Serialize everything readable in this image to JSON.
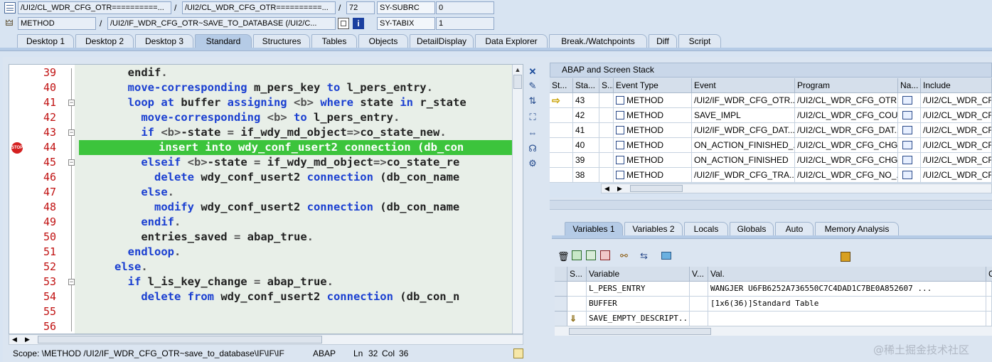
{
  "header": {
    "row1": {
      "class_field": "/UI2/CL_WDR_CFG_OTR==========...",
      "class_field2": "/UI2/CL_WDR_CFG_OTR==========...",
      "line_no": "72",
      "sysvar_name": "SY-SUBRC",
      "sysvar_value": "0",
      "separator": "/"
    },
    "row2": {
      "type": "METHOD",
      "method_path": "/UI2/IF_WDR_CFG_OTR~SAVE_TO_DATABASE (/UI2/C...",
      "sysvar_name": "SY-TABIX",
      "sysvar_value": "1",
      "separator": "/"
    }
  },
  "tabs": [
    "Desktop 1",
    "Desktop 2",
    "Desktop 3",
    "Standard",
    "Structures",
    "Tables",
    "Objects",
    "DetailDisplay",
    "Data Explorer",
    "Break./Watchpoints",
    "Diff",
    "Script"
  ],
  "active_tab": "Standard",
  "editor": {
    "lines": [
      {
        "n": "39",
        "parts": [
          [
            "",
            "        "
          ],
          [
            "",
            "endif"
          ],
          [
            "op",
            "."
          ]
        ]
      },
      {
        "n": "40",
        "parts": [
          [
            "",
            "        "
          ],
          [
            "kw",
            "move-corresponding"
          ],
          [
            "",
            " m_pers_key "
          ],
          [
            "kw",
            "to"
          ],
          [
            "",
            " l_pers_entry"
          ],
          [
            "op",
            "."
          ]
        ]
      },
      {
        "n": "41",
        "parts": [
          [
            "",
            "        "
          ],
          [
            "kw",
            "loop at"
          ],
          [
            "",
            " buffer "
          ],
          [
            "kw",
            "assigning"
          ],
          [
            "",
            " "
          ],
          [
            "op",
            "<b>"
          ],
          [
            "",
            " "
          ],
          [
            "kw",
            "where"
          ],
          [
            "",
            " state "
          ],
          [
            "kw",
            "in"
          ],
          [
            "",
            " r_state"
          ]
        ]
      },
      {
        "n": "42",
        "parts": [
          [
            "",
            "          "
          ],
          [
            "kw",
            "move-corresponding"
          ],
          [
            "",
            " "
          ],
          [
            "op",
            "<b>"
          ],
          [
            "",
            " "
          ],
          [
            "kw",
            "to"
          ],
          [
            "",
            " l_pers_entry"
          ],
          [
            "op",
            "."
          ]
        ]
      },
      {
        "n": "43",
        "parts": [
          [
            "",
            "          "
          ],
          [
            "kw",
            "if"
          ],
          [
            "",
            " "
          ],
          [
            "op",
            "<b>"
          ],
          [
            "",
            "-state "
          ],
          [
            "op",
            "="
          ],
          [
            "",
            " if_wdy_md_object"
          ],
          [
            "op",
            "=>"
          ],
          [
            "",
            "co_state_new"
          ],
          [
            "op",
            "."
          ]
        ]
      },
      {
        "n": "44",
        "parts": [
          [
            "",
            "            "
          ],
          [
            "kw",
            "insert into"
          ],
          [
            "",
            " wdy_conf_usert2 "
          ],
          [
            "kw",
            "connection"
          ],
          [
            "",
            " (db_con"
          ]
        ]
      },
      {
        "n": "45",
        "parts": [
          [
            "",
            "          "
          ],
          [
            "kw",
            "elseif"
          ],
          [
            "",
            " "
          ],
          [
            "op",
            "<b>"
          ],
          [
            "",
            "-state "
          ],
          [
            "op",
            "="
          ],
          [
            "",
            " if_wdy_md_object"
          ],
          [
            "op",
            "=>"
          ],
          [
            "",
            "co_state_re"
          ]
        ]
      },
      {
        "n": "46",
        "parts": [
          [
            "",
            "            "
          ],
          [
            "kw",
            "delete"
          ],
          [
            "",
            " wdy_conf_usert2 "
          ],
          [
            "kw",
            "connection"
          ],
          [
            "",
            " (db_con_name"
          ]
        ]
      },
      {
        "n": "47",
        "parts": [
          [
            "",
            "          "
          ],
          [
            "kw",
            "else"
          ],
          [
            "op",
            "."
          ]
        ]
      },
      {
        "n": "48",
        "parts": [
          [
            "",
            "            "
          ],
          [
            "kw",
            "modify"
          ],
          [
            "",
            " wdy_conf_usert2 "
          ],
          [
            "kw",
            "connection"
          ],
          [
            "",
            " (db_con_name"
          ]
        ]
      },
      {
        "n": "49",
        "parts": [
          [
            "",
            "          "
          ],
          [
            "kw",
            "endif"
          ],
          [
            "op",
            "."
          ]
        ]
      },
      {
        "n": "50",
        "parts": [
          [
            "",
            "          "
          ],
          [
            "",
            "entries_saved "
          ],
          [
            "op",
            "="
          ],
          [
            "",
            " abap_true"
          ],
          [
            "op",
            "."
          ]
        ]
      },
      {
        "n": "51",
        "parts": [
          [
            "",
            "        "
          ],
          [
            "kw",
            "endloop"
          ],
          [
            "op",
            "."
          ]
        ]
      },
      {
        "n": "52",
        "parts": [
          [
            "",
            "      "
          ],
          [
            "kw",
            "else"
          ],
          [
            "op",
            "."
          ]
        ]
      },
      {
        "n": "53",
        "parts": [
          [
            "",
            "        "
          ],
          [
            "kw",
            "if"
          ],
          [
            "",
            " l_is_key_change "
          ],
          [
            "op",
            "="
          ],
          [
            "",
            " abap_true"
          ],
          [
            "op",
            "."
          ]
        ]
      },
      {
        "n": "54",
        "parts": [
          [
            "",
            "          "
          ],
          [
            "kw",
            "delete from"
          ],
          [
            "",
            " wdy_conf_usert2 "
          ],
          [
            "kw",
            "connection"
          ],
          [
            "",
            " (db_con_n"
          ]
        ]
      },
      {
        "n": "55",
        "parts": []
      },
      {
        "n": "56",
        "parts": []
      }
    ],
    "current_line": "44",
    "breakpoint_line": "44"
  },
  "stack": {
    "title": "ABAP and Screen Stack",
    "columns": [
      "St...",
      "Sta...",
      "S...",
      "Event Type",
      "Event",
      "Program",
      "Na...",
      "Include"
    ],
    "rows": [
      {
        "level": "43",
        "type": "METHOD",
        "event": "/UI2/IF_WDR_CFG_OTR...",
        "program": "/UI2/CL_WDR_CFG_OTR...",
        "include": "/UI2/CL_WDR_CF"
      },
      {
        "level": "42",
        "type": "METHOD",
        "event": "SAVE_IMPL",
        "program": "/UI2/CL_WDR_CFG_COU...",
        "include": "/UI2/CL_WDR_CF"
      },
      {
        "level": "41",
        "type": "METHOD",
        "event": "/UI2/IF_WDR_CFG_DAT...",
        "program": "/UI2/CL_WDR_CFG_DAT...",
        "include": "/UI2/CL_WDR_CF"
      },
      {
        "level": "40",
        "type": "METHOD",
        "event": "ON_ACTION_FINISHED_...",
        "program": "/UI2/CL_WDR_CFG_CHG...",
        "include": "/UI2/CL_WDR_CF"
      },
      {
        "level": "39",
        "type": "METHOD",
        "event": "ON_ACTION_FINISHED",
        "program": "/UI2/CL_WDR_CFG_CHG...",
        "include": "/UI2/CL_WDR_CF"
      },
      {
        "level": "38",
        "type": "METHOD",
        "event": "/UI2/IF_WDR_CFG_TRA...",
        "program": "/UI2/CL_WDR_CFG_NO_...",
        "include": "/UI2/CL_WDR_CF"
      }
    ]
  },
  "vartabs": [
    "Variables 1",
    "Variables 2",
    "Locals",
    "Globals",
    "Auto",
    "Memory Analysis"
  ],
  "active_vartab": "Variables 1",
  "vars": {
    "columns": [
      "S...",
      "Variable",
      "V...",
      "Val.",
      "C"
    ],
    "rows": [
      {
        "name": "L_PERS_ENTRY",
        "value": "   WANGJER      U6FB6252A736550C7C4DAD1C7BE0A852607   ..."
      },
      {
        "name": "BUFFER",
        "value": "[1x6(36)]Standard Table"
      },
      {
        "name": "SAVE_EMPTY_DESCRIPT...",
        "value": ""
      }
    ]
  },
  "statusbar": {
    "scope": "Scope: \\METHOD /UI2/IF_WDR_CFG_OTR~save_to_database\\IF\\IF\\IF",
    "lang": "ABAP",
    "ln_label": "Ln",
    "ln": "32",
    "col_label": "Col",
    "col": "36"
  },
  "watermark": "@稀土掘金技术社区",
  "colors": {
    "accent": "#3cc43c",
    "keyword": "#1a3fd1",
    "line_number": "#c01010"
  }
}
